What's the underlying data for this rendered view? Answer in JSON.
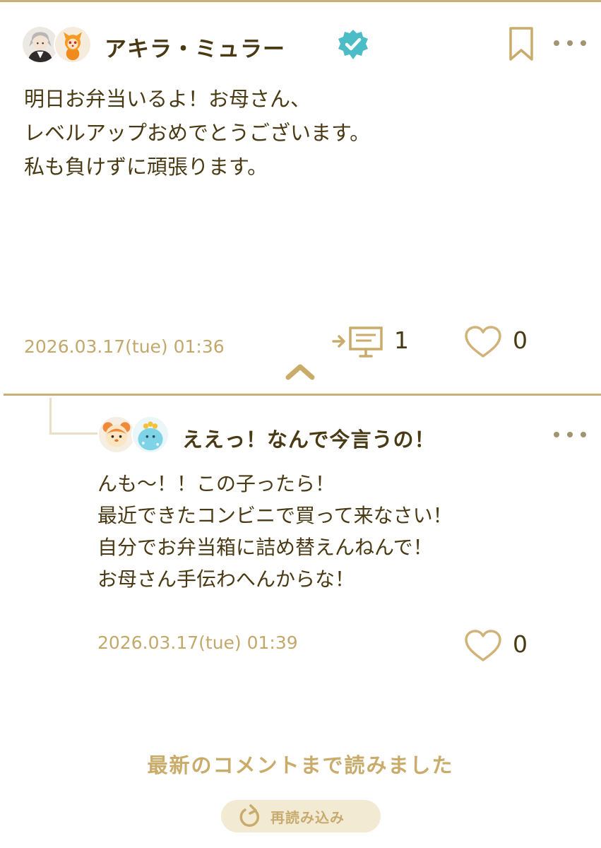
{
  "colors": {
    "accent_gold": "#c9b078",
    "text_brown": "#4a3a14",
    "timestamp_gold": "#c3a86c",
    "verified_teal": "#4cbcc6"
  },
  "post": {
    "author": "アキラ・ミュラー",
    "verified": true,
    "icons": [
      "verified-badge-icon",
      "bookmark-icon",
      "more-icon"
    ],
    "body_lines": [
      "明日お弁当いるよ！お母さん、",
      "レベルアップおめでとうございます。",
      "私も負けずに頑張ります。"
    ],
    "timestamp": "2026.03.17(tue) 01:36",
    "reply_count": "1",
    "like_count": "0"
  },
  "reply": {
    "author": "ええっ！なんで今言うの！",
    "body_lines": [
      "んも〜！！この子ったら！",
      "最近できたコンビニで買って来なさい！",
      "自分でお弁当箱に詰め替えんねんで！",
      "お母さん手伝わへんからな！"
    ],
    "timestamp": "2026.03.17(tue) 01:39",
    "like_count": "0"
  },
  "footer": {
    "all_read_text": "最新のコメントまで読みました",
    "reload_label": "再読み込み"
  }
}
